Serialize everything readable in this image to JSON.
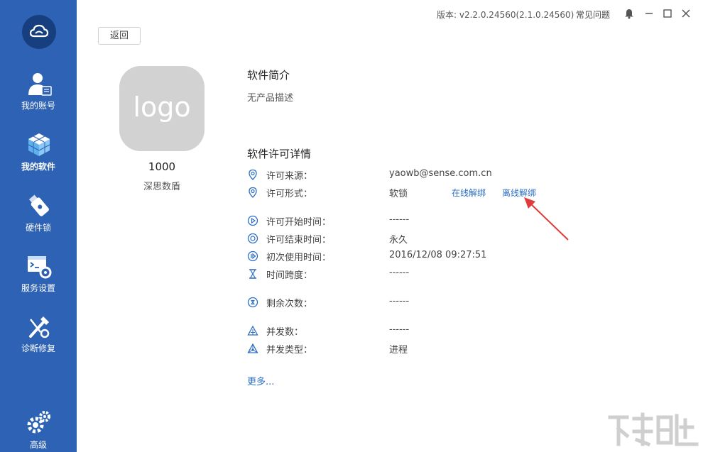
{
  "sidebar": {
    "items": [
      {
        "label": "我的账号",
        "icon": "account-icon"
      },
      {
        "label": "我的软件",
        "icon": "software-cube-icon"
      },
      {
        "label": "硬件锁",
        "icon": "usb-lock-icon"
      },
      {
        "label": "服务设置",
        "icon": "terminal-gear-icon"
      },
      {
        "label": "诊断修复",
        "icon": "repair-tool-icon"
      },
      {
        "label": "高级",
        "icon": "gears-icon"
      }
    ]
  },
  "titlebar": {
    "version": "版本: v2.2.0.24560(2.1.0.24560)",
    "faq": "常见问题"
  },
  "back_label": "返回",
  "product": {
    "logo_text": "logo",
    "id": "1000",
    "vendor": "深思数盾"
  },
  "intro": {
    "title": "软件简介",
    "description": "无产品描述"
  },
  "license": {
    "title": "软件许可详情",
    "source_label": "许可来源：",
    "source_value": "yaowb@sense.com.cn",
    "form_label": "许可形式：",
    "form_value": "软锁",
    "online_unbind": "在线解绑",
    "offline_unbind": "离线解绑",
    "start_label": "许可开始时间：",
    "start_value": "------",
    "end_label": "许可结束时间：",
    "end_value": "永久",
    "first_use_label": "初次使用时间：",
    "first_use_value": "2016/12/08 09:27:51",
    "span_label": "时间跨度：",
    "span_value": "------",
    "remaining_label": "剩余次数：",
    "remaining_value": "------",
    "concurrent_label": "并发数：",
    "concurrent_value": "------",
    "concurrent_type_label": "并发类型：",
    "concurrent_type_value": "进程"
  },
  "more_label": "更多...",
  "colors": {
    "sidebar": "#2d62b4",
    "link": "#2d6fc4",
    "annotation_arrow": "#e03a3a"
  }
}
